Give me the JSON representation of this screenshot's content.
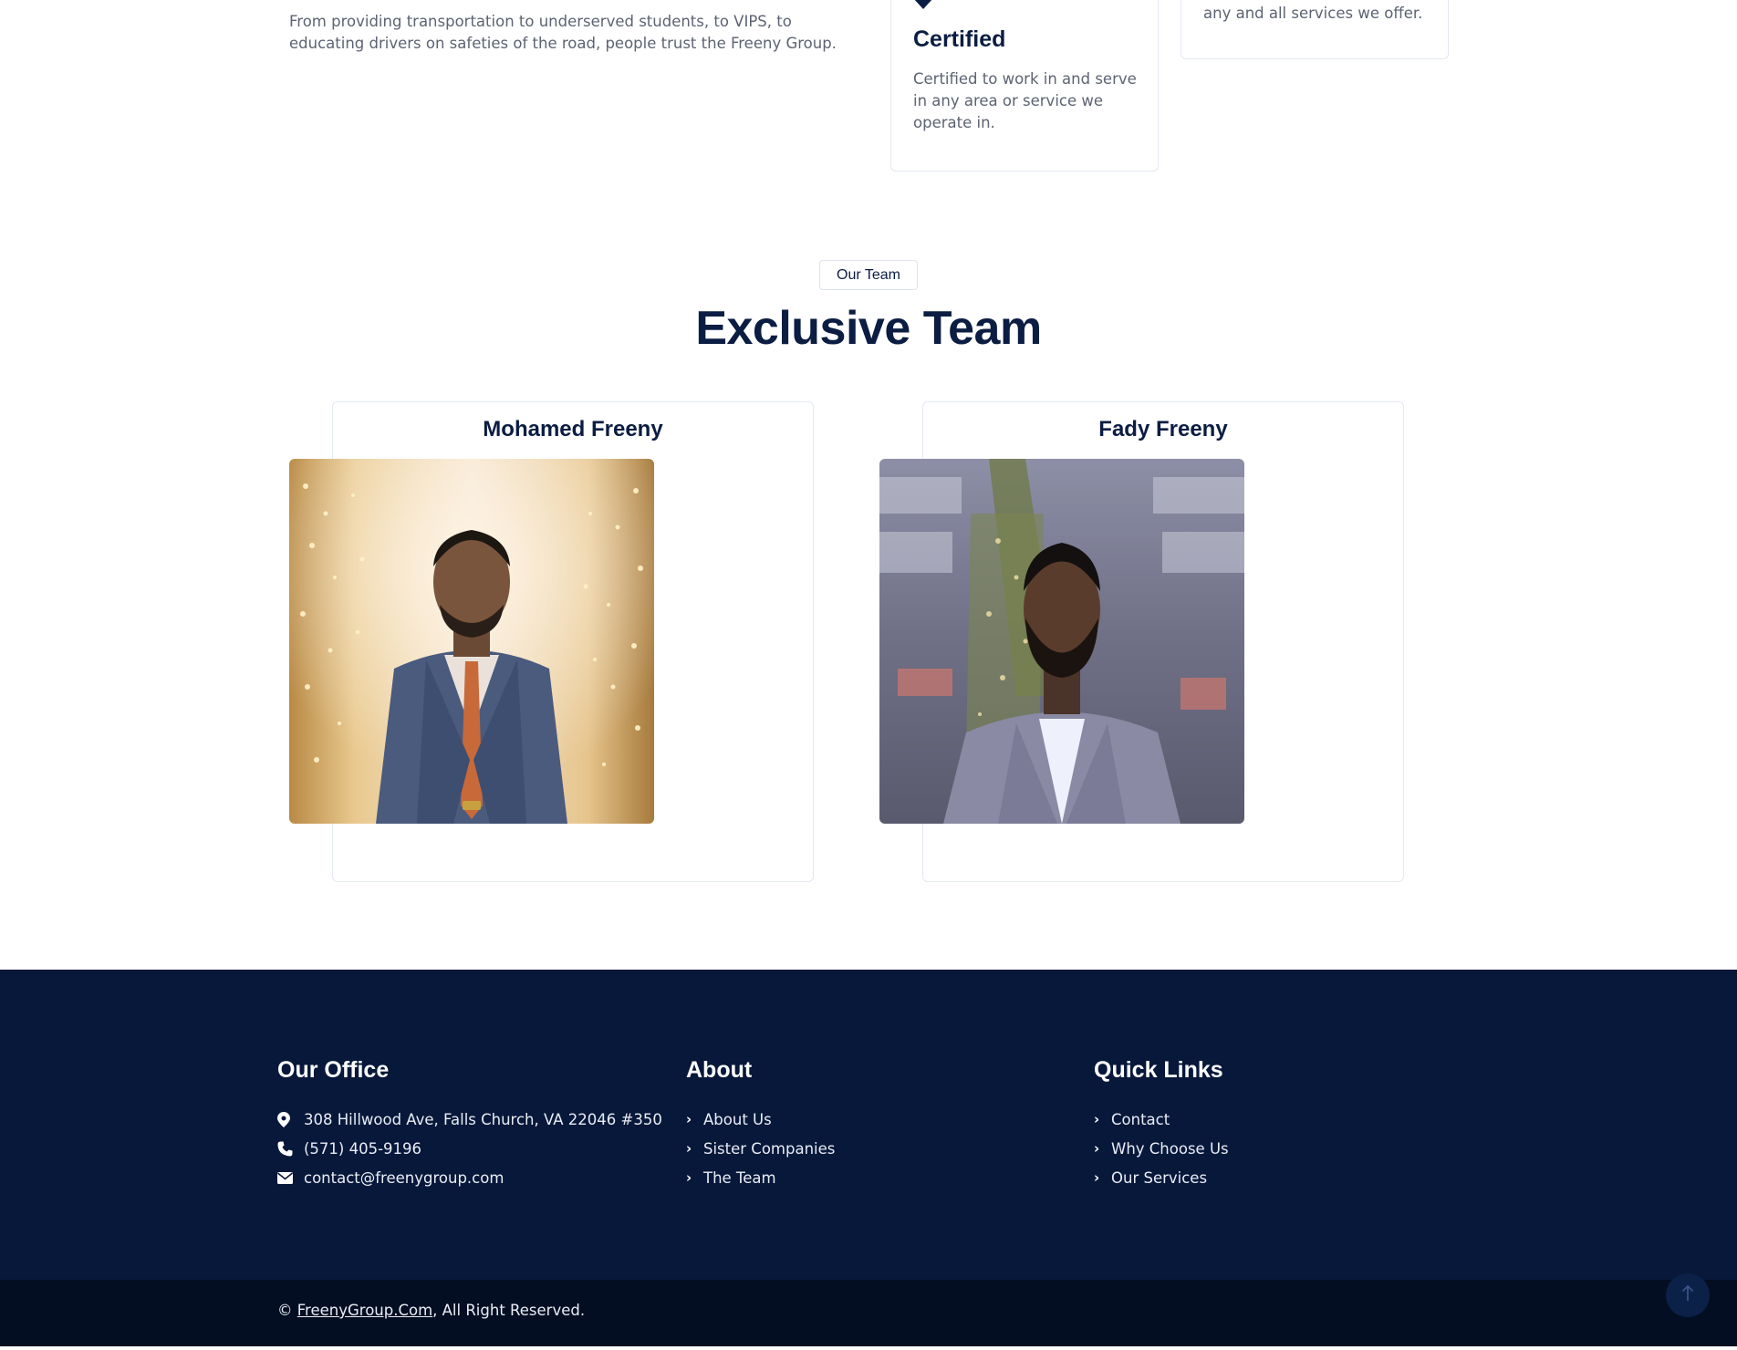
{
  "intro": {
    "text": "From providing transportation to underserved students, to VIPS, to educating drivers on safeties of the road, people trust the Freeny Group."
  },
  "features": {
    "certified": {
      "title": "Certified",
      "description": "Certified to work in and serve in any area or service we operate in."
    },
    "other": {
      "description": "any and all services we offer."
    }
  },
  "team": {
    "badge": "Our Team",
    "heading": "Exclusive Team",
    "members": [
      {
        "name": "Mohamed Freeny"
      },
      {
        "name": "Fady Freeny"
      }
    ]
  },
  "footer": {
    "office": {
      "title": "Our Office",
      "address": "308 Hillwood Ave, Falls Church, VA 22046 #350",
      "phone": "(571) 405-9196",
      "email": "contact@freenygroup.com"
    },
    "about": {
      "title": "About",
      "links": [
        "About Us",
        "Sister Companies",
        "The Team"
      ]
    },
    "quick_links": {
      "title": "Quick Links",
      "links": [
        "Contact",
        "Why Choose Us",
        "Our Services"
      ]
    },
    "copyright": {
      "prefix": "© ",
      "site": "FreenyGroup.Com",
      "suffix": ", All Right Reserved."
    }
  },
  "colors": {
    "navy": "#0b1d42",
    "footer_bg": "#07183a",
    "copyright_bg": "#030e22"
  },
  "icons": {
    "address": "map-marker-icon",
    "phone": "phone-icon",
    "email": "envelope-icon",
    "link": "chevron-right-icon",
    "back_to_top": "arrow-up-icon"
  }
}
